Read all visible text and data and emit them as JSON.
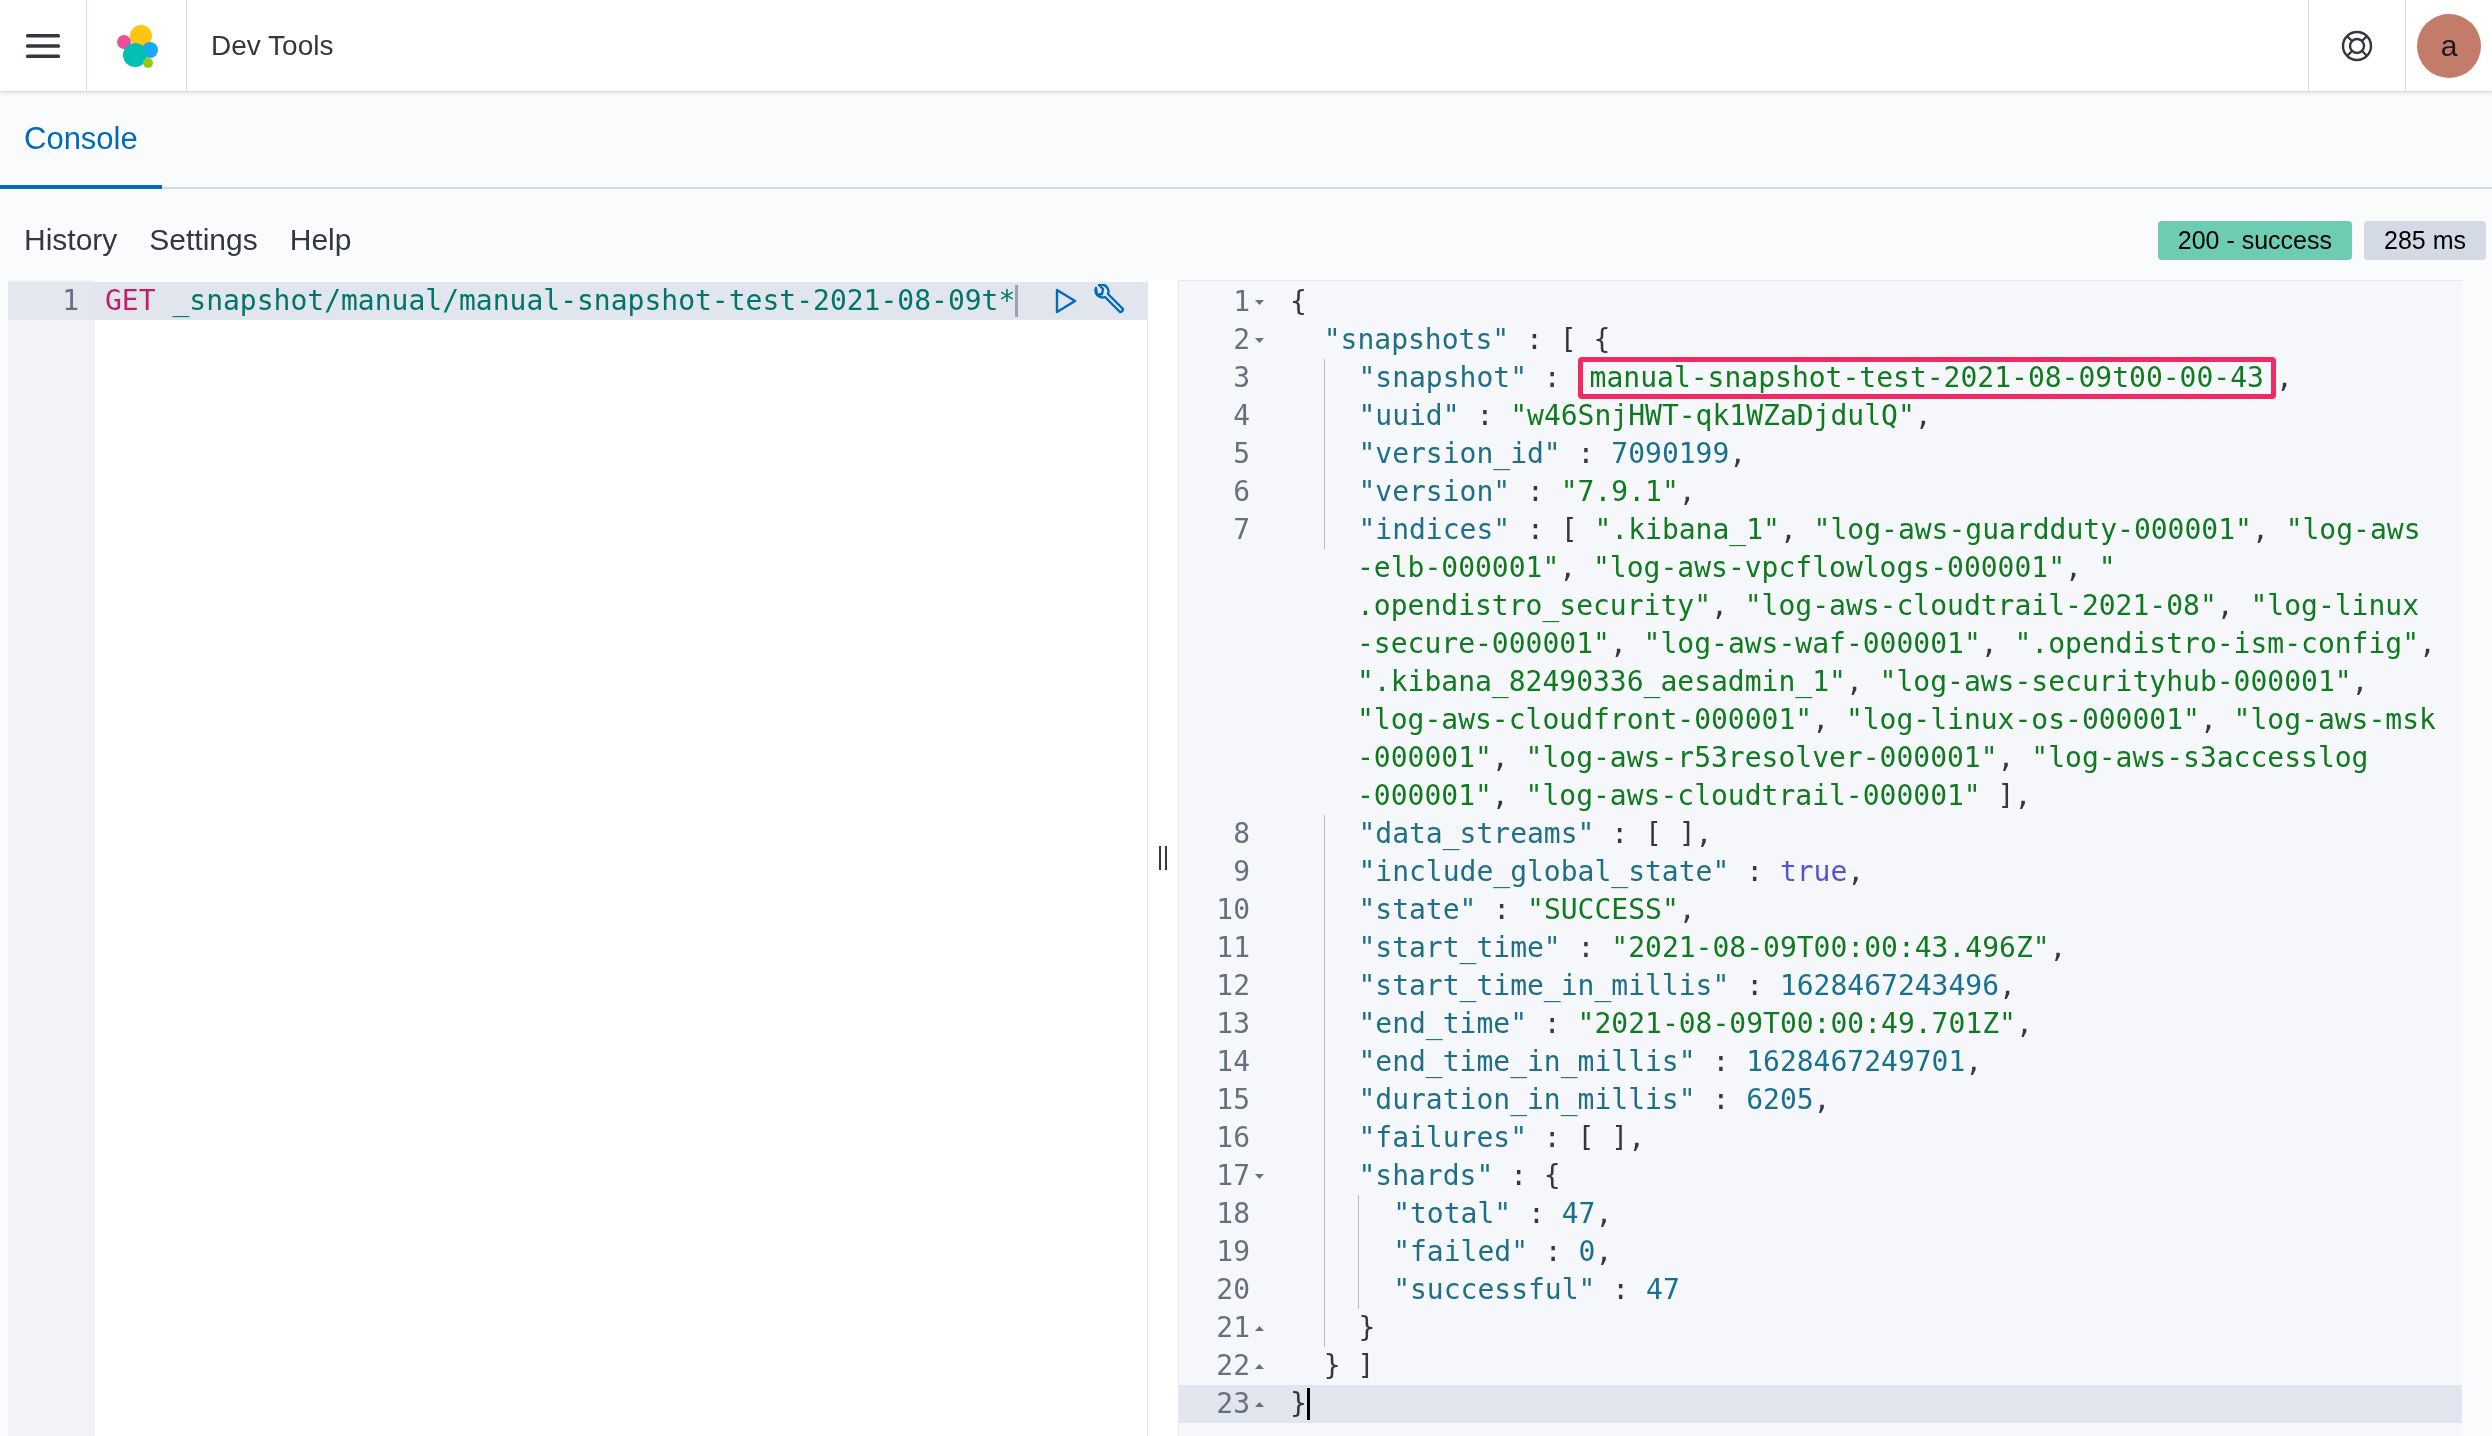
{
  "header": {
    "title": "Dev Tools",
    "avatar": "a"
  },
  "tabs": [
    {
      "label": "Console",
      "selected": true
    }
  ],
  "menu": [
    "History",
    "Settings",
    "Help"
  ],
  "status": {
    "code": "200 - success",
    "time": "285 ms"
  },
  "request": {
    "lines": [
      {
        "number": "1",
        "active": true,
        "rows": [
          {
            "tokens": [
              {
                "kind": "method",
                "text": "GET"
              },
              {
                "kind": "path",
                "text": " _snapshot/manual/manual-snapshot-test-2021-08-09t*"
              }
            ]
          }
        ]
      }
    ]
  },
  "response": {
    "lines": [
      {
        "number": "1",
        "fold": {
          "kind": "start"
        },
        "active": false,
        "rows": [
          {
            "tokens": [
              {
                "kind": "punct",
                "text": "{"
              }
            ]
          }
        ]
      },
      {
        "number": "2",
        "fold": {
          "kind": "start"
        },
        "active": false,
        "rows": [
          {
            "tokens": [
              {
                "kind": "key",
                "text": "  \"snapshots\""
              },
              {
                "kind": "punct",
                "text": " : [ {"
              }
            ]
          }
        ]
      },
      {
        "number": "3",
        "active": false,
        "rows": [
          {
            "tokens": [
              {
                "kind": "key",
                "text": "    \"snapshot\""
              },
              {
                "kind": "punct",
                "text": " : "
              },
              {
                "kind": "str",
                "text": "manual-snapshot-test-2021-08-09t00-00-43",
                "highlighted": true
              },
              {
                "kind": "punct",
                "text": ","
              }
            ]
          }
        ]
      },
      {
        "number": "4",
        "active": false,
        "rows": [
          {
            "tokens": [
              {
                "kind": "key",
                "text": "    \"uuid\""
              },
              {
                "kind": "punct",
                "text": " : "
              },
              {
                "kind": "str",
                "text": "\"w46SnjHWT-qk1WZaDjdulQ\""
              },
              {
                "kind": "punct",
                "text": ","
              }
            ]
          }
        ]
      },
      {
        "number": "5",
        "active": false,
        "rows": [
          {
            "tokens": [
              {
                "kind": "key",
                "text": "    \"version_id\""
              },
              {
                "kind": "punct",
                "text": " : "
              },
              {
                "kind": "num",
                "text": "7090199"
              },
              {
                "kind": "punct",
                "text": ","
              }
            ]
          }
        ]
      },
      {
        "number": "6",
        "active": false,
        "rows": [
          {
            "tokens": [
              {
                "kind": "key",
                "text": "    \"version\""
              },
              {
                "kind": "punct",
                "text": " : "
              },
              {
                "kind": "str",
                "text": "\"7.9.1\""
              },
              {
                "kind": "punct",
                "text": ","
              }
            ]
          }
        ]
      },
      {
        "number": "7",
        "active": false,
        "rows": [
          {
            "tokens": [
              {
                "kind": "key",
                "text": "    \"indices\""
              },
              {
                "kind": "punct",
                "text": " : [ "
              },
              {
                "kind": "str",
                "text": "\".kibana_1\""
              },
              {
                "kind": "punct",
                "text": ", "
              },
              {
                "kind": "str",
                "text": "\"log-aws-guardduty-000001\""
              },
              {
                "kind": "punct",
                "text": ", "
              },
              {
                "kind": "str",
                "text": "\"log-aws"
              }
            ]
          },
          {
            "tokens": [
              {
                "kind": "str",
                "text": "-elb-000001\""
              },
              {
                "kind": "punct",
                "text": ", "
              },
              {
                "kind": "str",
                "text": "\"log-aws-vpcflowlogs-000001\""
              },
              {
                "kind": "punct",
                "text": ", "
              },
              {
                "kind": "str",
                "text": "\""
              }
            ]
          },
          {
            "tokens": [
              {
                "kind": "str",
                "text": ".opendistro_security\""
              },
              {
                "kind": "punct",
                "text": ", "
              },
              {
                "kind": "str",
                "text": "\"log-aws-cloudtrail-2021-08\""
              },
              {
                "kind": "punct",
                "text": ", "
              },
              {
                "kind": "str",
                "text": "\"log-linux"
              }
            ]
          },
          {
            "tokens": [
              {
                "kind": "str",
                "text": "-secure-000001\""
              },
              {
                "kind": "punct",
                "text": ", "
              },
              {
                "kind": "str",
                "text": "\"log-aws-waf-000001\""
              },
              {
                "kind": "punct",
                "text": ", "
              },
              {
                "kind": "str",
                "text": "\".opendistro-ism-config\""
              },
              {
                "kind": "punct",
                "text": ","
              }
            ]
          },
          {
            "tokens": [
              {
                "kind": "str",
                "text": "\".kibana_82490336_aesadmin_1\""
              },
              {
                "kind": "punct",
                "text": ", "
              },
              {
                "kind": "str",
                "text": "\"log-aws-securityhub-000001\""
              },
              {
                "kind": "punct",
                "text": ","
              }
            ]
          },
          {
            "tokens": [
              {
                "kind": "str",
                "text": "\"log-aws-cloudfront-000001\""
              },
              {
                "kind": "punct",
                "text": ", "
              },
              {
                "kind": "str",
                "text": "\"log-linux-os-000001\""
              },
              {
                "kind": "punct",
                "text": ", "
              },
              {
                "kind": "str",
                "text": "\"log-aws-msk"
              }
            ]
          },
          {
            "tokens": [
              {
                "kind": "str",
                "text": "-000001\""
              },
              {
                "kind": "punct",
                "text": ", "
              },
              {
                "kind": "str",
                "text": "\"log-aws-r53resolver-000001\""
              },
              {
                "kind": "punct",
                "text": ", "
              },
              {
                "kind": "str",
                "text": "\"log-aws-s3accesslog"
              }
            ]
          },
          {
            "tokens": [
              {
                "kind": "str",
                "text": "-000001\""
              },
              {
                "kind": "punct",
                "text": ", "
              },
              {
                "kind": "str",
                "text": "\"log-aws-cloudtrail-000001\""
              },
              {
                "kind": "punct",
                "text": " ],"
              }
            ]
          }
        ]
      },
      {
        "number": "8",
        "active": false,
        "rows": [
          {
            "tokens": [
              {
                "kind": "key",
                "text": "    \"data_streams\""
              },
              {
                "kind": "punct",
                "text": " : [ ],"
              }
            ]
          }
        ]
      },
      {
        "number": "9",
        "active": false,
        "rows": [
          {
            "tokens": [
              {
                "kind": "key",
                "text": "    \"include_global_state\""
              },
              {
                "kind": "punct",
                "text": " : "
              },
              {
                "kind": "bool",
                "text": "true"
              },
              {
                "kind": "punct",
                "text": ","
              }
            ]
          }
        ]
      },
      {
        "number": "10",
        "active": false,
        "rows": [
          {
            "tokens": [
              {
                "kind": "key",
                "text": "    \"state\""
              },
              {
                "kind": "punct",
                "text": " : "
              },
              {
                "kind": "str",
                "text": "\"SUCCESS\""
              },
              {
                "kind": "punct",
                "text": ","
              }
            ]
          }
        ]
      },
      {
        "number": "11",
        "active": false,
        "rows": [
          {
            "tokens": [
              {
                "kind": "key",
                "text": "    \"start_time\""
              },
              {
                "kind": "punct",
                "text": " : "
              },
              {
                "kind": "str",
                "text": "\"2021-08-09T00:00:43.496Z\""
              },
              {
                "kind": "punct",
                "text": ","
              }
            ]
          }
        ]
      },
      {
        "number": "12",
        "active": false,
        "rows": [
          {
            "tokens": [
              {
                "kind": "key",
                "text": "    \"start_time_in_millis\""
              },
              {
                "kind": "punct",
                "text": " : "
              },
              {
                "kind": "num",
                "text": "1628467243496"
              },
              {
                "kind": "punct",
                "text": ","
              }
            ]
          }
        ]
      },
      {
        "number": "13",
        "active": false,
        "rows": [
          {
            "tokens": [
              {
                "kind": "key",
                "text": "    \"end_time\""
              },
              {
                "kind": "punct",
                "text": " : "
              },
              {
                "kind": "str",
                "text": "\"2021-08-09T00:00:49.701Z\""
              },
              {
                "kind": "punct",
                "text": ","
              }
            ]
          }
        ]
      },
      {
        "number": "14",
        "active": false,
        "rows": [
          {
            "tokens": [
              {
                "kind": "key",
                "text": "    \"end_time_in_millis\""
              },
              {
                "kind": "punct",
                "text": " : "
              },
              {
                "kind": "num",
                "text": "1628467249701"
              },
              {
                "kind": "punct",
                "text": ","
              }
            ]
          }
        ]
      },
      {
        "number": "15",
        "active": false,
        "rows": [
          {
            "tokens": [
              {
                "kind": "key",
                "text": "    \"duration_in_millis\""
              },
              {
                "kind": "punct",
                "text": " : "
              },
              {
                "kind": "num",
                "text": "6205"
              },
              {
                "kind": "punct",
                "text": ","
              }
            ]
          }
        ]
      },
      {
        "number": "16",
        "active": false,
        "rows": [
          {
            "tokens": [
              {
                "kind": "key",
                "text": "    \"failures\""
              },
              {
                "kind": "punct",
                "text": " : [ ],"
              }
            ]
          }
        ]
      },
      {
        "number": "17",
        "fold": {
          "kind": "start"
        },
        "active": false,
        "rows": [
          {
            "tokens": [
              {
                "kind": "key",
                "text": "    \"shards\""
              },
              {
                "kind": "punct",
                "text": " : {"
              }
            ]
          }
        ]
      },
      {
        "number": "18",
        "active": false,
        "rows": [
          {
            "tokens": [
              {
                "kind": "key",
                "text": "      \"total\""
              },
              {
                "kind": "punct",
                "text": " : "
              },
              {
                "kind": "num",
                "text": "47"
              },
              {
                "kind": "punct",
                "text": ","
              }
            ]
          }
        ]
      },
      {
        "number": "19",
        "active": false,
        "rows": [
          {
            "tokens": [
              {
                "kind": "key",
                "text": "      \"failed\""
              },
              {
                "kind": "punct",
                "text": " : "
              },
              {
                "kind": "num",
                "text": "0"
              },
              {
                "kind": "punct",
                "text": ","
              }
            ]
          }
        ]
      },
      {
        "number": "20",
        "active": false,
        "rows": [
          {
            "tokens": [
              {
                "kind": "key",
                "text": "      \"successful\""
              },
              {
                "kind": "punct",
                "text": " : "
              },
              {
                "kind": "num",
                "text": "47"
              }
            ]
          }
        ]
      },
      {
        "number": "21",
        "fold": {
          "kind": "end"
        },
        "active": false,
        "rows": [
          {
            "tokens": [
              {
                "kind": "punct",
                "text": "    }"
              }
            ]
          }
        ]
      },
      {
        "number": "22",
        "fold": {
          "kind": "end"
        },
        "active": false,
        "rows": [
          {
            "tokens": [
              {
                "kind": "punct",
                "text": "  } ]"
              }
            ]
          }
        ]
      },
      {
        "number": "23",
        "fold": {
          "kind": "end"
        },
        "active": true,
        "rows": [
          {
            "tokens": [
              {
                "kind": "punct",
                "text": "}"
              }
            ]
          }
        ]
      }
    ]
  }
}
